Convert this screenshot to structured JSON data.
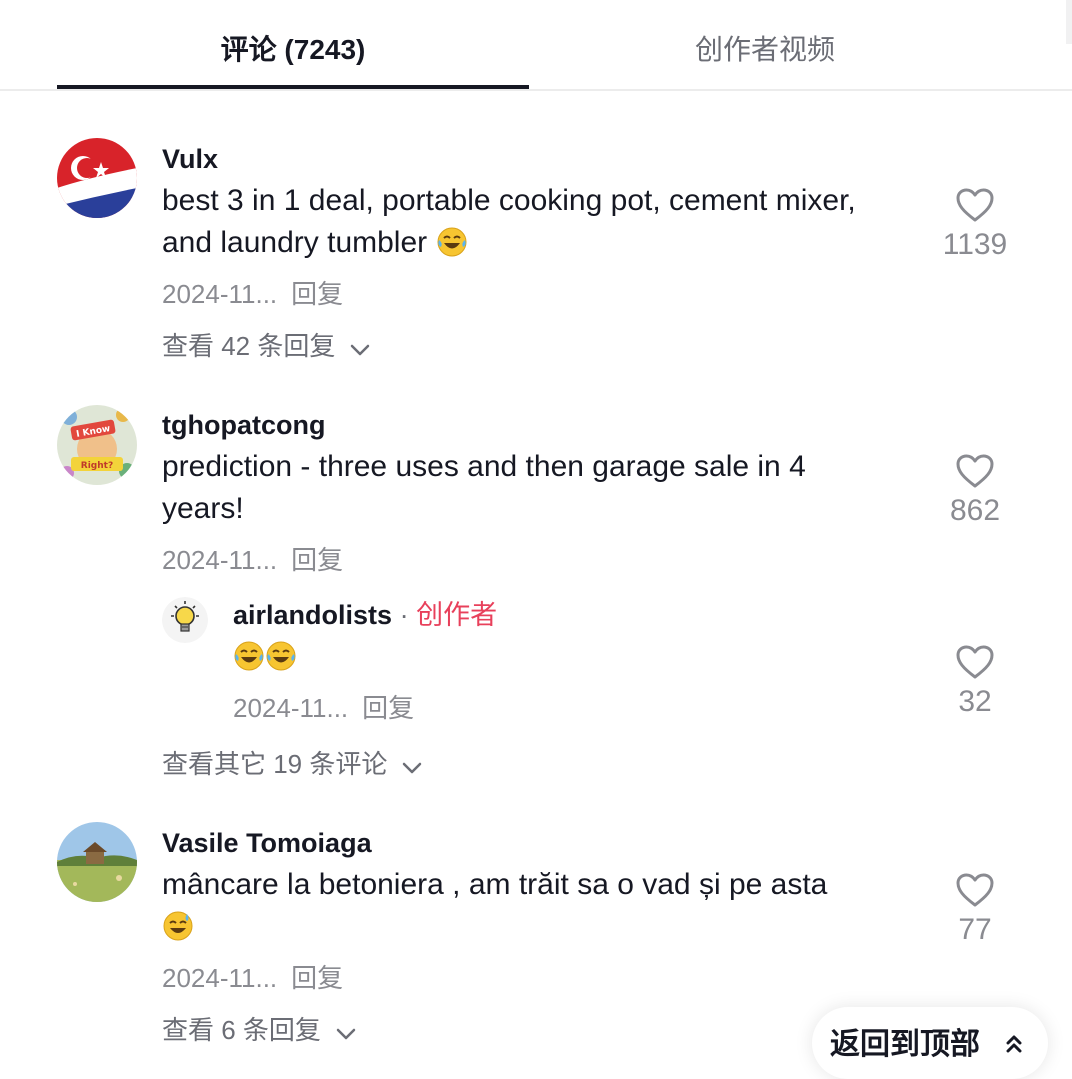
{
  "tabs": {
    "comments_label": "评论 (7243)",
    "creator_videos_label": "创作者视频"
  },
  "comments": [
    {
      "username": "Vulx",
      "text": "best 3 in 1 deal, portable cooking pot, cement mixer, and laundry tumbler",
      "emoji": "laughing-tears",
      "date": "2024-11...",
      "reply_label": "回复",
      "likes": "1139",
      "view_replies": "查看 42 条回复"
    },
    {
      "username": "tghopatcong",
      "text_line1": "prediction - three uses and then garage sale in 4",
      "text_line2": "years!",
      "date": "2024-11...",
      "reply_label": "回复",
      "likes": "862",
      "avatar_text_1": "I Know",
      "avatar_text_2": "Right?",
      "reply": {
        "username": "airlandolists",
        "separator": "·",
        "creator_tag": "创作者",
        "emoji": "laughing-tears x2",
        "date": "2024-11...",
        "reply_label": "回复",
        "likes": "32"
      },
      "view_replies": "查看其它 19 条评论"
    },
    {
      "username": "Vasile Tomoiaga",
      "text": "mâncare la betoniera , am trăit sa o vad și pe asta",
      "emoji": "sweat-smile",
      "date": "2024-11...",
      "reply_label": "回复",
      "likes": "77",
      "view_replies": "查看 6 条回复"
    }
  ],
  "back_to_top": {
    "label": "返回到顶部",
    "icon": "double-chevron-up-icon"
  },
  "colors": {
    "text_primary": "#161823",
    "text_secondary": "#8a8b91",
    "creator_accent": "#e8405b",
    "underline": "#161823"
  }
}
